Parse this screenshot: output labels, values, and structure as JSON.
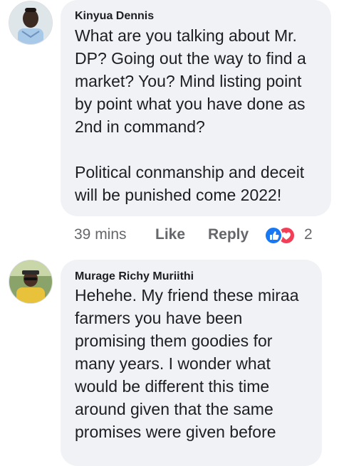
{
  "comments": [
    {
      "author": "Kinyua Dennis",
      "text": "What are you talking about Mr. DP? Going out the way to find a market? You? Mind listing point by point what you have done as 2nd in command?\n\nPolitical conmanship and deceit will be punished come 2022!",
      "time": "39 mins",
      "like_label": "Like",
      "reply_label": "Reply",
      "reaction_count": "2",
      "reactions": [
        "like-icon",
        "love-icon"
      ]
    },
    {
      "author": "Murage Richy Muriithi",
      "text": "Hehehe. My friend these miraa farmers you have been promising them goodies for many years. I wonder what would be different this time around given that the same promises were given before"
    }
  ],
  "colors": {
    "bubble": "#f0f2f5",
    "text": "#1c1e21",
    "meta": "#65676b",
    "like": "#1877f2",
    "love": "#f33e58"
  }
}
